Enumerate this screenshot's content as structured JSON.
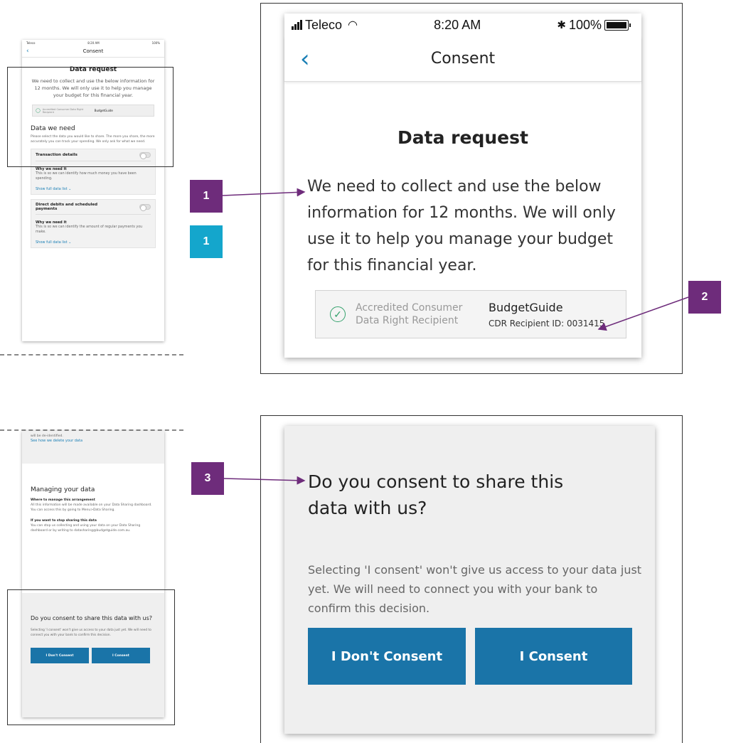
{
  "colors": {
    "marker_purple": "#6e2c7b",
    "marker_teal": "#14a6cc",
    "button_blue": "#1a74a8",
    "link_blue": "#1a7fb5",
    "check_green": "#35a26d"
  },
  "markers": {
    "m1a": "1",
    "m1b": "1",
    "m2": "2",
    "m3": "3"
  },
  "status": {
    "carrier": "Teleco",
    "time": "8:20 AM",
    "battery": "100%"
  },
  "nav": {
    "title": "Consent"
  },
  "data_request": {
    "heading": "Data request",
    "body": "We need to collect and use the below information for 12 months. We will only use it to help you manage your budget for this financial year.",
    "accredited": "Accredited Consumer Data Right Recipient",
    "recipient_name": "BudgetGuide",
    "recipient_id": "CDR Recipient ID: 0031415"
  },
  "thumb_top": {
    "carrier": "Teleco",
    "time": "8:20 AM",
    "battery": "100%",
    "data_we_need": "Data we need",
    "intro": "Please select the data you would like to share. The more you share, the more accurately you can track your spending. We only ask for what we need.",
    "cards": [
      {
        "title": "Transaction details",
        "why": "Why we need it",
        "text": "This is so we can identify how much money you have been spending.",
        "link": "Show full data list"
      },
      {
        "title": "Direct debits and scheduled payments",
        "why": "Why we need it",
        "text": "This is so we can identify the amount of regular payments you make.",
        "link": "Show full data list"
      }
    ]
  },
  "thumb_bottom": {
    "deidentified": "will be de-identified.",
    "delete_link": "See how we delete your data",
    "managing": "Managing your data",
    "where_title": "Where to manage this arrangement",
    "where_text": "All this information will be made available on your Data Sharing dashboard. You can access this by going to Menu>Data Sharing.",
    "stop_title": "If you want to stop sharing this data",
    "stop_text": "You can stop us collecting and using your data on your Data Sharing dashboard or by writing to datasharing@budgetguide.com.au."
  },
  "consent": {
    "question": "Do you consent to share this data with us?",
    "explanation": "Selecting 'I consent' won't give us access to your data just yet. We will need to connect you with your bank to confirm this decision.",
    "decline_label": "I Don't Consent",
    "accept_label": "I Consent"
  }
}
